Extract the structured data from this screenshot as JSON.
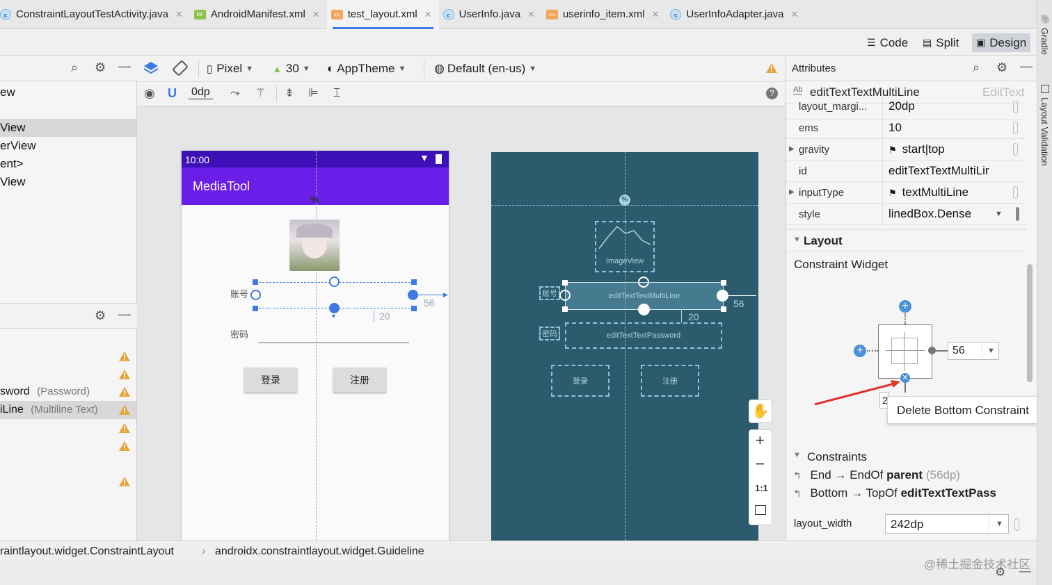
{
  "tabs": [
    {
      "label": "ConstraintLayoutTestActivity.java",
      "icon": "java-class-icon",
      "active": false
    },
    {
      "label": "AndroidManifest.xml",
      "icon": "manifest-icon",
      "active": false
    },
    {
      "label": "test_layout.xml",
      "icon": "xml-file-icon",
      "active": true
    },
    {
      "label": "UserInfo.java",
      "icon": "java-class-icon",
      "active": false
    },
    {
      "label": "userinfo_item.xml",
      "icon": "xml-file-icon",
      "active": false
    },
    {
      "label": "UserInfoAdapter.java",
      "icon": "java-class-icon",
      "active": false
    }
  ],
  "side_tools": {
    "gradle": "Gradle",
    "layout_validation": "Layout Validation"
  },
  "modes": {
    "code": "Code",
    "split": "Split",
    "design": "Design",
    "selected": "Design"
  },
  "palette": {
    "items": [
      "ew",
      "View",
      "erView",
      "ent>",
      "View"
    ],
    "selected_index": 1
  },
  "component_tree": {
    "rows": [
      {
        "name": "sword",
        "type": "(Password)"
      },
      {
        "name": "iLine",
        "type": "(Multiline Text)"
      }
    ],
    "selected_index": 1
  },
  "design_toolbar": {
    "device": "Pixel",
    "api": "30",
    "theme": "AppTheme",
    "locale": "Default (en-us)",
    "margin": "0dp"
  },
  "phone": {
    "time": "10:00",
    "app_title": "MediaTool",
    "label_account": "账号",
    "label_password": "密码",
    "btn_login": "登录",
    "btn_register": "注册",
    "guideline_marker": "%",
    "margin_end": "56",
    "margin_bottom": "20"
  },
  "blueprint": {
    "image_view": "ImageView",
    "edit_multiline": "editTextTextMultiLine",
    "edit_password": "editTextTextPassword",
    "label_account": "账号",
    "label_password": "密码",
    "btn_login": "登录",
    "btn_register": "注册",
    "margin_end": "56",
    "margin_bottom": "20",
    "guideline_marker": "%"
  },
  "zoom_controls": {
    "one_to_one": "1:1"
  },
  "attributes": {
    "title": "Attributes",
    "component_id": "editTextTextMultiLine",
    "component_type": "EditText",
    "rows": [
      {
        "name": "layout_margi...",
        "value": "20dp",
        "expandable": false
      },
      {
        "name": "ems",
        "value": "10",
        "expandable": false
      },
      {
        "name": "gravity",
        "value": "start|top",
        "expandable": true,
        "flag": true
      },
      {
        "name": "id",
        "value": "editTextTextMultiLir",
        "expandable": false
      },
      {
        "name": "inputType",
        "value": "textMultiLine",
        "expandable": true,
        "flag": true
      },
      {
        "name": "style",
        "value": "linedBox.Dense",
        "expandable": false,
        "dropdown": true
      }
    ],
    "layout_section": "Layout",
    "constraint_widget_title": "Constraint Widget",
    "end_margin": "56",
    "bottom_partial": "2",
    "tooltip": "Delete Bottom Constraint",
    "constraints_section": "Constraints",
    "constraints": [
      {
        "side": "End",
        "arrow": "→",
        "target_prefix": "EndOf",
        "target": "parent",
        "margin": "(56dp)"
      },
      {
        "side": "Bottom",
        "arrow": "→",
        "target_prefix": "TopOf",
        "target": "editTextTextPass",
        "margin": ""
      }
    ],
    "layout_width_label": "layout_width",
    "layout_width_value": "242dp"
  },
  "status_bar": {
    "breadcrumb_1": "raintlayout.widget.ConstraintLayout",
    "separator": "›",
    "breadcrumb_2": "androidx.constraintlayout.widget.Guideline"
  },
  "watermark": "@稀土掘金技术社区",
  "colors": {
    "accent": "#3d7ae3",
    "app_bar": "#6a1ee8",
    "status_bar": "#3d10b8",
    "blueprint_bg": "#2c5b6e",
    "warning": "#e8a33a",
    "red_arrow": "#e0332a"
  }
}
